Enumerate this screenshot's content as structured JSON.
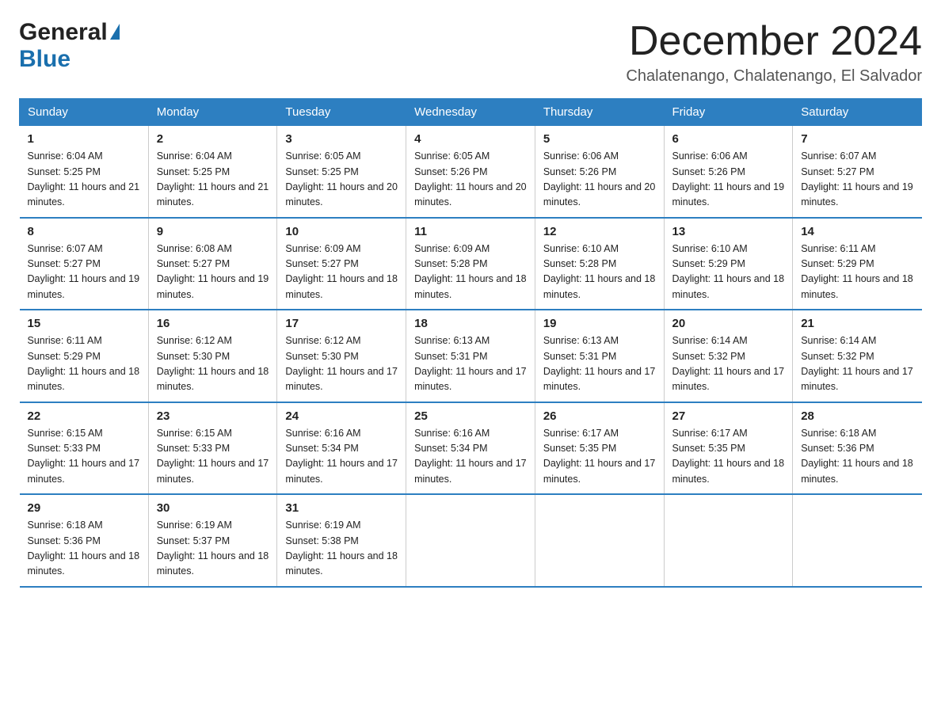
{
  "logo": {
    "general": "General",
    "blue": "Blue"
  },
  "title": "December 2024",
  "location": "Chalatenango, Chalatenango, El Salvador",
  "days_of_week": [
    "Sunday",
    "Monday",
    "Tuesday",
    "Wednesday",
    "Thursday",
    "Friday",
    "Saturday"
  ],
  "weeks": [
    [
      {
        "day": "1",
        "sunrise": "6:04 AM",
        "sunset": "5:25 PM",
        "daylight": "11 hours and 21 minutes."
      },
      {
        "day": "2",
        "sunrise": "6:04 AM",
        "sunset": "5:25 PM",
        "daylight": "11 hours and 21 minutes."
      },
      {
        "day": "3",
        "sunrise": "6:05 AM",
        "sunset": "5:25 PM",
        "daylight": "11 hours and 20 minutes."
      },
      {
        "day": "4",
        "sunrise": "6:05 AM",
        "sunset": "5:26 PM",
        "daylight": "11 hours and 20 minutes."
      },
      {
        "day": "5",
        "sunrise": "6:06 AM",
        "sunset": "5:26 PM",
        "daylight": "11 hours and 20 minutes."
      },
      {
        "day": "6",
        "sunrise": "6:06 AM",
        "sunset": "5:26 PM",
        "daylight": "11 hours and 19 minutes."
      },
      {
        "day": "7",
        "sunrise": "6:07 AM",
        "sunset": "5:27 PM",
        "daylight": "11 hours and 19 minutes."
      }
    ],
    [
      {
        "day": "8",
        "sunrise": "6:07 AM",
        "sunset": "5:27 PM",
        "daylight": "11 hours and 19 minutes."
      },
      {
        "day": "9",
        "sunrise": "6:08 AM",
        "sunset": "5:27 PM",
        "daylight": "11 hours and 19 minutes."
      },
      {
        "day": "10",
        "sunrise": "6:09 AM",
        "sunset": "5:27 PM",
        "daylight": "11 hours and 18 minutes."
      },
      {
        "day": "11",
        "sunrise": "6:09 AM",
        "sunset": "5:28 PM",
        "daylight": "11 hours and 18 minutes."
      },
      {
        "day": "12",
        "sunrise": "6:10 AM",
        "sunset": "5:28 PM",
        "daylight": "11 hours and 18 minutes."
      },
      {
        "day": "13",
        "sunrise": "6:10 AM",
        "sunset": "5:29 PM",
        "daylight": "11 hours and 18 minutes."
      },
      {
        "day": "14",
        "sunrise": "6:11 AM",
        "sunset": "5:29 PM",
        "daylight": "11 hours and 18 minutes."
      }
    ],
    [
      {
        "day": "15",
        "sunrise": "6:11 AM",
        "sunset": "5:29 PM",
        "daylight": "11 hours and 18 minutes."
      },
      {
        "day": "16",
        "sunrise": "6:12 AM",
        "sunset": "5:30 PM",
        "daylight": "11 hours and 18 minutes."
      },
      {
        "day": "17",
        "sunrise": "6:12 AM",
        "sunset": "5:30 PM",
        "daylight": "11 hours and 17 minutes."
      },
      {
        "day": "18",
        "sunrise": "6:13 AM",
        "sunset": "5:31 PM",
        "daylight": "11 hours and 17 minutes."
      },
      {
        "day": "19",
        "sunrise": "6:13 AM",
        "sunset": "5:31 PM",
        "daylight": "11 hours and 17 minutes."
      },
      {
        "day": "20",
        "sunrise": "6:14 AM",
        "sunset": "5:32 PM",
        "daylight": "11 hours and 17 minutes."
      },
      {
        "day": "21",
        "sunrise": "6:14 AM",
        "sunset": "5:32 PM",
        "daylight": "11 hours and 17 minutes."
      }
    ],
    [
      {
        "day": "22",
        "sunrise": "6:15 AM",
        "sunset": "5:33 PM",
        "daylight": "11 hours and 17 minutes."
      },
      {
        "day": "23",
        "sunrise": "6:15 AM",
        "sunset": "5:33 PM",
        "daylight": "11 hours and 17 minutes."
      },
      {
        "day": "24",
        "sunrise": "6:16 AM",
        "sunset": "5:34 PM",
        "daylight": "11 hours and 17 minutes."
      },
      {
        "day": "25",
        "sunrise": "6:16 AM",
        "sunset": "5:34 PM",
        "daylight": "11 hours and 17 minutes."
      },
      {
        "day": "26",
        "sunrise": "6:17 AM",
        "sunset": "5:35 PM",
        "daylight": "11 hours and 17 minutes."
      },
      {
        "day": "27",
        "sunrise": "6:17 AM",
        "sunset": "5:35 PM",
        "daylight": "11 hours and 18 minutes."
      },
      {
        "day": "28",
        "sunrise": "6:18 AM",
        "sunset": "5:36 PM",
        "daylight": "11 hours and 18 minutes."
      }
    ],
    [
      {
        "day": "29",
        "sunrise": "6:18 AM",
        "sunset": "5:36 PM",
        "daylight": "11 hours and 18 minutes."
      },
      {
        "day": "30",
        "sunrise": "6:19 AM",
        "sunset": "5:37 PM",
        "daylight": "11 hours and 18 minutes."
      },
      {
        "day": "31",
        "sunrise": "6:19 AM",
        "sunset": "5:38 PM",
        "daylight": "11 hours and 18 minutes."
      },
      null,
      null,
      null,
      null
    ]
  ],
  "labels": {
    "sunrise": "Sunrise: ",
    "sunset": "Sunset: ",
    "daylight": "Daylight: "
  }
}
